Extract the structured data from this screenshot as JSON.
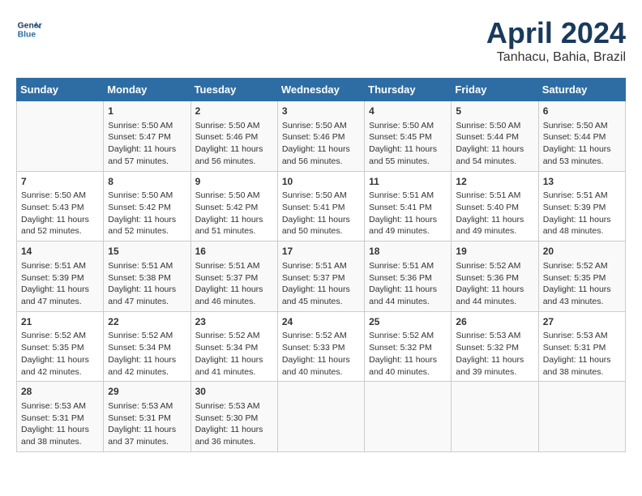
{
  "header": {
    "logo_line1": "General",
    "logo_line2": "Blue",
    "month": "April 2024",
    "location": "Tanhacu, Bahia, Brazil"
  },
  "days_of_week": [
    "Sunday",
    "Monday",
    "Tuesday",
    "Wednesday",
    "Thursday",
    "Friday",
    "Saturday"
  ],
  "weeks": [
    [
      {
        "day": "",
        "content": ""
      },
      {
        "day": "1",
        "content": "Sunrise: 5:50 AM\nSunset: 5:47 PM\nDaylight: 11 hours\nand 57 minutes."
      },
      {
        "day": "2",
        "content": "Sunrise: 5:50 AM\nSunset: 5:46 PM\nDaylight: 11 hours\nand 56 minutes."
      },
      {
        "day": "3",
        "content": "Sunrise: 5:50 AM\nSunset: 5:46 PM\nDaylight: 11 hours\nand 56 minutes."
      },
      {
        "day": "4",
        "content": "Sunrise: 5:50 AM\nSunset: 5:45 PM\nDaylight: 11 hours\nand 55 minutes."
      },
      {
        "day": "5",
        "content": "Sunrise: 5:50 AM\nSunset: 5:44 PM\nDaylight: 11 hours\nand 54 minutes."
      },
      {
        "day": "6",
        "content": "Sunrise: 5:50 AM\nSunset: 5:44 PM\nDaylight: 11 hours\nand 53 minutes."
      }
    ],
    [
      {
        "day": "7",
        "content": "Sunrise: 5:50 AM\nSunset: 5:43 PM\nDaylight: 11 hours\nand 52 minutes."
      },
      {
        "day": "8",
        "content": "Sunrise: 5:50 AM\nSunset: 5:42 PM\nDaylight: 11 hours\nand 52 minutes."
      },
      {
        "day": "9",
        "content": "Sunrise: 5:50 AM\nSunset: 5:42 PM\nDaylight: 11 hours\nand 51 minutes."
      },
      {
        "day": "10",
        "content": "Sunrise: 5:50 AM\nSunset: 5:41 PM\nDaylight: 11 hours\nand 50 minutes."
      },
      {
        "day": "11",
        "content": "Sunrise: 5:51 AM\nSunset: 5:41 PM\nDaylight: 11 hours\nand 49 minutes."
      },
      {
        "day": "12",
        "content": "Sunrise: 5:51 AM\nSunset: 5:40 PM\nDaylight: 11 hours\nand 49 minutes."
      },
      {
        "day": "13",
        "content": "Sunrise: 5:51 AM\nSunset: 5:39 PM\nDaylight: 11 hours\nand 48 minutes."
      }
    ],
    [
      {
        "day": "14",
        "content": "Sunrise: 5:51 AM\nSunset: 5:39 PM\nDaylight: 11 hours\nand 47 minutes."
      },
      {
        "day": "15",
        "content": "Sunrise: 5:51 AM\nSunset: 5:38 PM\nDaylight: 11 hours\nand 47 minutes."
      },
      {
        "day": "16",
        "content": "Sunrise: 5:51 AM\nSunset: 5:37 PM\nDaylight: 11 hours\nand 46 minutes."
      },
      {
        "day": "17",
        "content": "Sunrise: 5:51 AM\nSunset: 5:37 PM\nDaylight: 11 hours\nand 45 minutes."
      },
      {
        "day": "18",
        "content": "Sunrise: 5:51 AM\nSunset: 5:36 PM\nDaylight: 11 hours\nand 44 minutes."
      },
      {
        "day": "19",
        "content": "Sunrise: 5:52 AM\nSunset: 5:36 PM\nDaylight: 11 hours\nand 44 minutes."
      },
      {
        "day": "20",
        "content": "Sunrise: 5:52 AM\nSunset: 5:35 PM\nDaylight: 11 hours\nand 43 minutes."
      }
    ],
    [
      {
        "day": "21",
        "content": "Sunrise: 5:52 AM\nSunset: 5:35 PM\nDaylight: 11 hours\nand 42 minutes."
      },
      {
        "day": "22",
        "content": "Sunrise: 5:52 AM\nSunset: 5:34 PM\nDaylight: 11 hours\nand 42 minutes."
      },
      {
        "day": "23",
        "content": "Sunrise: 5:52 AM\nSunset: 5:34 PM\nDaylight: 11 hours\nand 41 minutes."
      },
      {
        "day": "24",
        "content": "Sunrise: 5:52 AM\nSunset: 5:33 PM\nDaylight: 11 hours\nand 40 minutes."
      },
      {
        "day": "25",
        "content": "Sunrise: 5:52 AM\nSunset: 5:32 PM\nDaylight: 11 hours\nand 40 minutes."
      },
      {
        "day": "26",
        "content": "Sunrise: 5:53 AM\nSunset: 5:32 PM\nDaylight: 11 hours\nand 39 minutes."
      },
      {
        "day": "27",
        "content": "Sunrise: 5:53 AM\nSunset: 5:31 PM\nDaylight: 11 hours\nand 38 minutes."
      }
    ],
    [
      {
        "day": "28",
        "content": "Sunrise: 5:53 AM\nSunset: 5:31 PM\nDaylight: 11 hours\nand 38 minutes."
      },
      {
        "day": "29",
        "content": "Sunrise: 5:53 AM\nSunset: 5:31 PM\nDaylight: 11 hours\nand 37 minutes."
      },
      {
        "day": "30",
        "content": "Sunrise: 5:53 AM\nSunset: 5:30 PM\nDaylight: 11 hours\nand 36 minutes."
      },
      {
        "day": "",
        "content": ""
      },
      {
        "day": "",
        "content": ""
      },
      {
        "day": "",
        "content": ""
      },
      {
        "day": "",
        "content": ""
      }
    ]
  ]
}
